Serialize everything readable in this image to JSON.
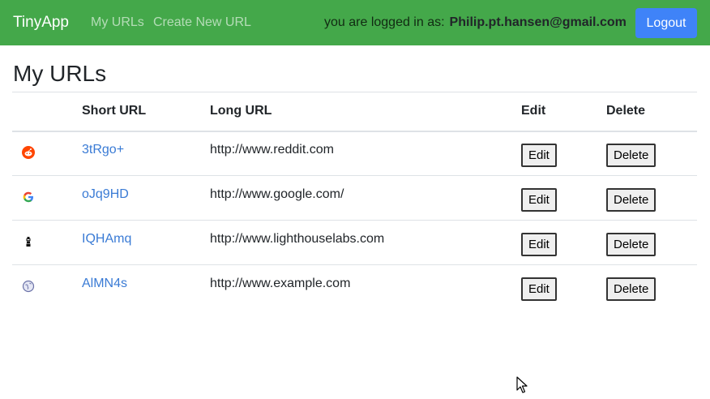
{
  "navbar": {
    "brand": "TinyApp",
    "links": [
      "My URLs",
      "Create New URL"
    ],
    "login_prefix": "you are logged in as:",
    "user_email": "Philip.pt.hansen@gmail.com",
    "logout_label": "Logout",
    "background_color": "#44a84a",
    "logout_color": "#3f83f8"
  },
  "page": {
    "title": "My URLs"
  },
  "table": {
    "headers": [
      "",
      "Short URL",
      "Long URL",
      "Edit",
      "Delete"
    ],
    "rows": [
      {
        "favicon": "reddit-icon",
        "short_url": "3tRgo+",
        "long_url": "http://www.reddit.com",
        "edit_label": "Edit",
        "delete_label": "Delete"
      },
      {
        "favicon": "google-icon",
        "short_url": "oJq9HD",
        "long_url": "http://www.google.com/",
        "edit_label": "Edit",
        "delete_label": "Delete"
      },
      {
        "favicon": "lighthouselabs-icon",
        "short_url": "IQHAmq",
        "long_url": "http://www.lighthouselabs.com",
        "edit_label": "Edit",
        "delete_label": "Delete"
      },
      {
        "favicon": "globe-icon",
        "short_url": "AlMN4s",
        "long_url": "http://www.example.com",
        "edit_label": "Edit",
        "delete_label": "Delete"
      }
    ]
  },
  "colors": {
    "link": "#3a7bd5"
  }
}
